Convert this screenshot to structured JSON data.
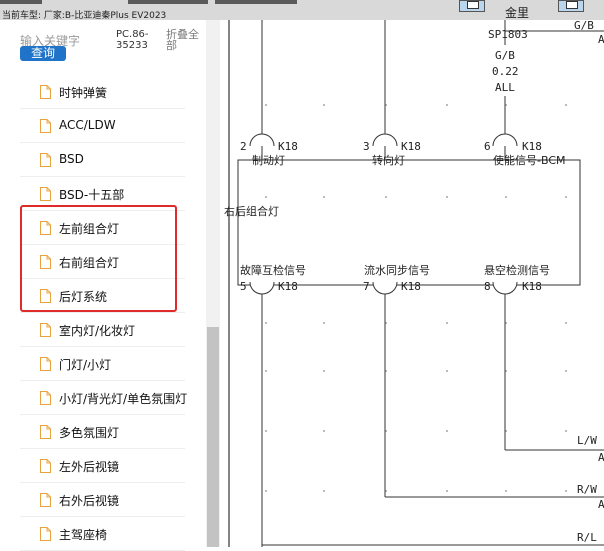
{
  "topbar": {
    "vehicle_info": "当前车型:  厂家:B-比亚迪秦Plus EV2023",
    "window_label": "金里"
  },
  "sidebar": {
    "search_placeholder": "输入关键字",
    "search_button": "查询",
    "code": "PC.86-35233",
    "collapse_all": "折叠全部",
    "items": [
      {
        "label": "时钟弹簧"
      },
      {
        "label": "ACC/LDW"
      },
      {
        "label": "BSD"
      },
      {
        "label": "BSD-十五部"
      },
      {
        "label": "左前组合灯"
      },
      {
        "label": "右前组合灯"
      },
      {
        "label": "后灯系统"
      },
      {
        "label": "室内灯/化妆灯"
      },
      {
        "label": "门灯/小灯"
      },
      {
        "label": "小灯/背光灯/单色氛围灯"
      },
      {
        "label": "多色氛围灯"
      },
      {
        "label": "左外后视镜"
      },
      {
        "label": "右外后视镜"
      },
      {
        "label": "主驾座椅"
      }
    ],
    "highlight_color": "#e02b2b"
  },
  "diagram": {
    "splice": "SP1803",
    "wire_color_gb": "G/B",
    "wire_size": "0.22",
    "wire_all": "ALL",
    "top_right_wire": "G/B",
    "top_right_pin": "A",
    "pins_top": [
      {
        "num": "2",
        "conn": "K18",
        "label": "制动灯"
      },
      {
        "num": "3",
        "conn": "K18",
        "label": "转向灯"
      },
      {
        "num": "6",
        "conn": "K18",
        "label": "使能信号-BCM"
      }
    ],
    "module_label": "右后组合灯",
    "pins_bottom": [
      {
        "num": "5",
        "conn": "K18",
        "label": "故障互检信号"
      },
      {
        "num": "7",
        "conn": "K18",
        "label": "流水同步信号"
      },
      {
        "num": "8",
        "conn": "K18",
        "label": "悬空检测信号"
      }
    ],
    "wires_right": [
      {
        "color": "L/W",
        "pin": "A"
      },
      {
        "color": "R/W",
        "pin": "A"
      },
      {
        "color": "R/L",
        "pin": ""
      }
    ]
  }
}
